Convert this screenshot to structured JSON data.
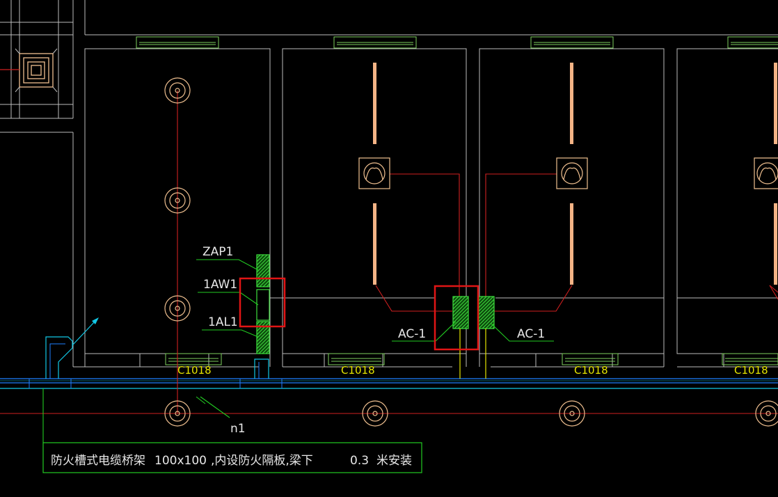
{
  "labels": {
    "zap1": "ZAP1",
    "aw1": "1AW1",
    "al1": "1AL1",
    "ac_left": "AC-1",
    "ac_right": "AC-1",
    "n1": "n1",
    "windows": [
      "C1018",
      "C1018",
      "C1018",
      "C1018"
    ],
    "note_name": "防火槽式电缆桥架",
    "note_size": "100x100",
    "note_desc": ",内设防火隔板,梁下",
    "note_value": "0.3",
    "note_unit": "米安装"
  },
  "colors": {
    "background": "#000000",
    "wall": "#bdbdbd",
    "wiring": "#d02020",
    "highlight": "#e01515",
    "panel": "#2fd12f",
    "tray": "#1e7fff",
    "leader": "#22cc22",
    "label": "#e8e8e8",
    "window_label": "#e6e600",
    "lamp": "#f4b486",
    "cyan": "#12c8e6"
  }
}
